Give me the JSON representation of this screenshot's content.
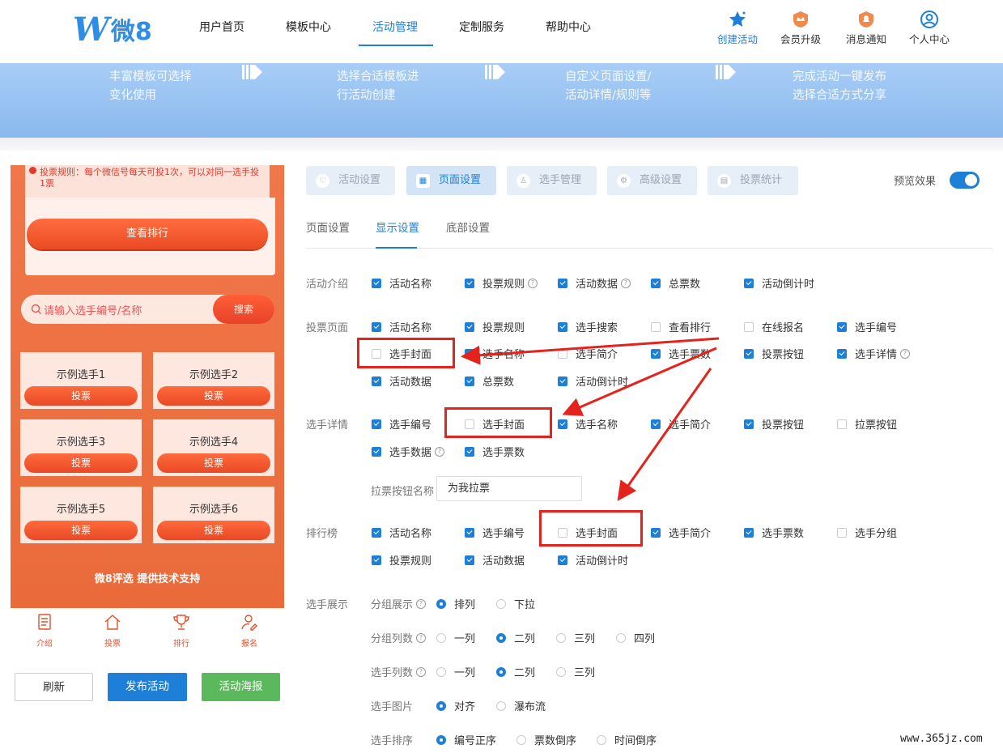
{
  "header": {
    "logo": {
      "mark": "W",
      "text": "微8"
    },
    "nav": [
      "用户首页",
      "模板中心",
      "活动管理",
      "定制服务",
      "帮助中心"
    ],
    "active_nav": "活动管理",
    "right": [
      {
        "label": "创建活动",
        "icon": "star-icon",
        "color": "#1e7fd8"
      },
      {
        "label": "会员升级",
        "icon": "crown-badge-icon",
        "color": "#f08a4b"
      },
      {
        "label": "消息通知",
        "icon": "bell-badge-icon",
        "color": "#f08a4b"
      },
      {
        "label": "个人中心",
        "icon": "user-icon",
        "color": "#1e7fd8"
      }
    ]
  },
  "banner": {
    "steps": [
      {
        "line1": "丰富模板可选择",
        "line2": "变化使用"
      },
      {
        "line1": "选择合适模板进",
        "line2": "行活动创建"
      },
      {
        "line1": "自定义页面设置/",
        "line2": "活动详情/规则等"
      },
      {
        "line1": "完成活动一键发布",
        "line2": "选择合适方式分享"
      }
    ]
  },
  "preview": {
    "rule_text": "投票规则：每个微信号每天可投1次，可以对同一选手投1票",
    "rank_button": "查看排行",
    "search_placeholder": "请输入选手编号/名称",
    "search_button": "搜索",
    "players": [
      "示例选手1",
      "示例选手2",
      "示例选手3",
      "示例选手4",
      "示例选手5",
      "示例选手6"
    ],
    "vote_label": "投票",
    "support": "微8评选 提供技术支持",
    "tabs": [
      {
        "label": "介绍",
        "icon": "document-icon"
      },
      {
        "label": "投票",
        "icon": "home-icon"
      },
      {
        "label": "排行",
        "icon": "trophy-icon"
      },
      {
        "label": "报名",
        "icon": "user-edit-icon"
      }
    ]
  },
  "actions": {
    "refresh": "刷新",
    "publish": "发布活动",
    "poster": "活动海报"
  },
  "top_tabs": [
    {
      "label": "活动设置",
      "icon": "heart-icon",
      "active": false
    },
    {
      "label": "页面设置",
      "icon": "layout-icon",
      "active": true
    },
    {
      "label": "选手管理",
      "icon": "person-icon",
      "active": false
    },
    {
      "label": "高级设置",
      "icon": "sliders-icon",
      "active": false
    },
    {
      "label": "投票统计",
      "icon": "chart-icon",
      "active": false
    }
  ],
  "preview_toggle": {
    "label": "预览效果",
    "on": true
  },
  "sub_tabs": [
    "页面设置",
    "显示设置",
    "底部设置"
  ],
  "active_sub_tab": "显示设置",
  "sections": {
    "intro": {
      "label": "活动介绍",
      "items": [
        {
          "label": "活动名称",
          "checked": true
        },
        {
          "label": "投票规则",
          "checked": true,
          "help": true
        },
        {
          "label": "活动数据",
          "checked": true,
          "help": true
        },
        {
          "label": "总票数",
          "checked": true
        },
        {
          "label": "活动倒计时",
          "checked": true
        }
      ]
    },
    "vote_page": {
      "label": "投票页面",
      "items": [
        {
          "label": "活动名称",
          "checked": true
        },
        {
          "label": "投票规则",
          "checked": true
        },
        {
          "label": "选手搜索",
          "checked": true
        },
        {
          "label": "查看排行",
          "checked": false
        },
        {
          "label": "在线报名",
          "checked": false
        },
        {
          "label": "选手编号",
          "checked": true
        },
        {
          "label": "选手封面",
          "checked": false
        },
        {
          "label": "选手名称",
          "checked": true
        },
        {
          "label": "选手简介",
          "checked": false
        },
        {
          "label": "选手票数",
          "checked": true
        },
        {
          "label": "投票按钮",
          "checked": true
        },
        {
          "label": "选手详情",
          "checked": true,
          "help": true
        },
        {
          "label": "活动数据",
          "checked": true
        },
        {
          "label": "总票数",
          "checked": true
        },
        {
          "label": "活动倒计时",
          "checked": true
        }
      ]
    },
    "player_detail": {
      "label": "选手详情",
      "items": [
        {
          "label": "选手编号",
          "checked": true
        },
        {
          "label": "选手封面",
          "checked": false
        },
        {
          "label": "选手名称",
          "checked": true
        },
        {
          "label": "选手简介",
          "checked": true
        },
        {
          "label": "投票按钮",
          "checked": true
        },
        {
          "label": "拉票按钮",
          "checked": false
        },
        {
          "label": "选手数据",
          "checked": true,
          "help": true
        },
        {
          "label": "选手票数",
          "checked": true
        }
      ],
      "canvass_label": "拉票按钮名称",
      "canvass_value": "为我拉票"
    },
    "ranking": {
      "label": "排行榜",
      "items": [
        {
          "label": "活动名称",
          "checked": true
        },
        {
          "label": "选手编号",
          "checked": true
        },
        {
          "label": "选手封面",
          "checked": false
        },
        {
          "label": "选手简介",
          "checked": true
        },
        {
          "label": "选手票数",
          "checked": true
        },
        {
          "label": "选手分组",
          "checked": false
        },
        {
          "label": "投票规则",
          "checked": true
        },
        {
          "label": "活动数据",
          "checked": true
        },
        {
          "label": "活动倒计时",
          "checked": true
        }
      ]
    },
    "display": {
      "label": "选手展示",
      "rows": [
        {
          "label": "分组展示",
          "help": true,
          "options": [
            "排列",
            "下拉"
          ],
          "selected": 0
        },
        {
          "label": "分组列数",
          "help": true,
          "options": [
            "一列",
            "二列",
            "三列",
            "四列"
          ],
          "selected": 1
        },
        {
          "label": "选手列数",
          "help": true,
          "options": [
            "一列",
            "二列",
            "三列"
          ],
          "selected": 1
        },
        {
          "label": "选手图片",
          "help": false,
          "options": [
            "对齐",
            "瀑布流"
          ],
          "selected": 0
        },
        {
          "label": "选手排序",
          "help": false,
          "options": [
            "编号正序",
            "票数倒序",
            "时间倒序"
          ],
          "selected": 0
        }
      ]
    }
  },
  "help_glyph": "?",
  "watermark": "www.365jz.com",
  "colors": {
    "accent": "#1e7fd8",
    "orange": "#ea6a3a",
    "green": "#5cb85c",
    "annotation": "#e4231c"
  }
}
